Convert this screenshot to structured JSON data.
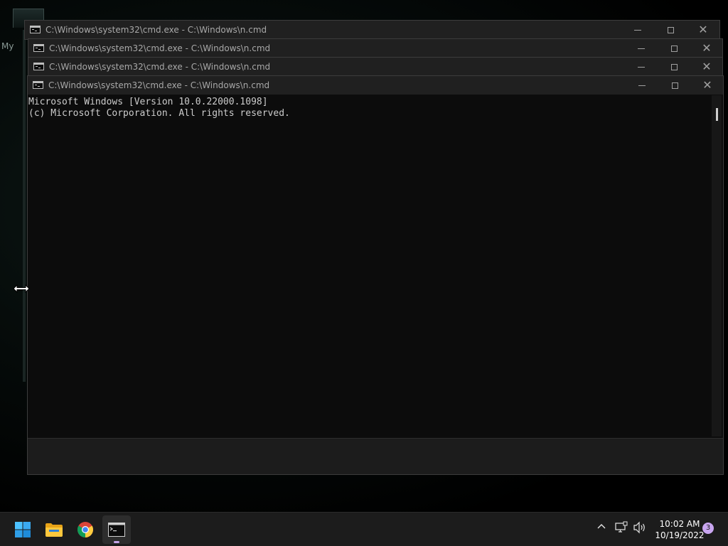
{
  "desktop": {
    "fragment_text": "My"
  },
  "windows": [
    {
      "title": "C:\\Windows\\system32\\cmd.exe - C:\\Windows\\n.cmd"
    },
    {
      "title": "C:\\Windows\\system32\\cmd.exe - C:\\Windows\\n.cmd"
    },
    {
      "title": "C:\\Windows\\system32\\cmd.exe - C:\\Windows\\n.cmd"
    },
    {
      "title": "C:\\Windows\\system32\\cmd.exe - C:\\Windows\\n.cmd"
    }
  ],
  "console": {
    "line1": "Microsoft Windows [Version 10.0.22000.1098]",
    "line2": "(c) Microsoft Corporation. All rights reserved."
  },
  "taskbar": {
    "apps": [
      {
        "name": "start",
        "icon": "windows-logo-icon"
      },
      {
        "name": "file-explorer",
        "icon": "folder-icon"
      },
      {
        "name": "chrome",
        "icon": "chrome-icon"
      },
      {
        "name": "command-prompt",
        "icon": "terminal-icon",
        "active": true
      }
    ],
    "tray": {
      "chevron": "^",
      "time": "10:02 AM",
      "date": "10/19/2022",
      "notification_count": "3"
    }
  },
  "colors": {
    "console_bg": "#0c0c0c",
    "console_text": "#cccccc",
    "titlebar_bg": "#202020",
    "taskbar_bg": "#1c1c1c",
    "accent": "#c9a6f0"
  }
}
